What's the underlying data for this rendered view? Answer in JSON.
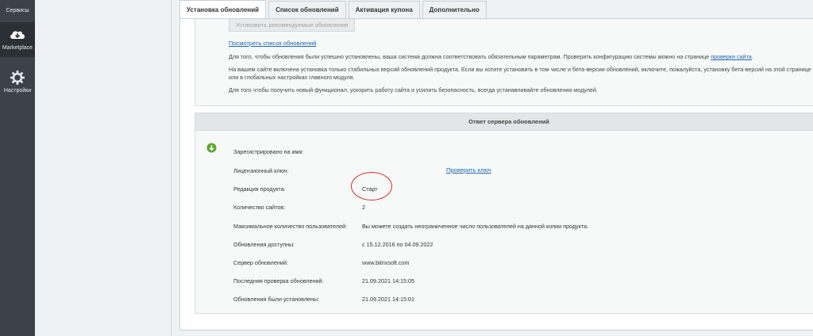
{
  "sidebar": {
    "items": [
      {
        "label": "Сервисы",
        "icon": "services-icon"
      },
      {
        "label": "Marketplace",
        "icon": "cloud-download-icon"
      },
      {
        "label": "Настройки",
        "icon": "gear-icon"
      }
    ]
  },
  "tabs": [
    {
      "label": "Установка обновлений"
    },
    {
      "label": "Список обновлений"
    },
    {
      "label": "Активация купона"
    },
    {
      "label": "Дополнительно"
    }
  ],
  "info": {
    "install_button": "Установить рекомендуемые обновления",
    "view_list_link": "Посмотреть список обновлений",
    "p1_text": "Для того, чтобы обновления были успешно установлены, ваша система должна соответствовать обязательным параметрам. Проверить конфигурацию системы можно на странице ",
    "p1_link": "проверки сайта",
    "p1_end": ".",
    "p2": "На вашем сайте включена установка только стабильных версий обновлений продукта. Если вы хотите установить в том числе и бета-версии обновлений, включите, пожалуйста, установку бета-версий на этой странице или в глобальных настройках главного модуля.",
    "p3": "Для того чтобы получить новый функционал, ускорить работу сайта и усилить безопасность, всегда устанавливайте обновления модулей."
  },
  "response": {
    "header": "Ответ сервера обновлений",
    "rows": [
      {
        "label": "Зарегистрировано на имя:",
        "value": ""
      },
      {
        "label": "Лицензионный ключ:",
        "value": ""
      },
      {
        "label": "Редакция продукта:",
        "value": "Старт"
      },
      {
        "label": "Количество сайтов:",
        "value": "2"
      },
      {
        "label": "Максимальное количество пользователей:",
        "value": "Вы можете создать неограниченное число пользователей на данной копии продукта."
      },
      {
        "label": "Обновления доступны:",
        "value": "с 15.12.2016 по 04.09.2022"
      },
      {
        "label": "Сервер обновлений:",
        "value": "www.bitrixsoft.com"
      },
      {
        "label": "Последняя проверка обновлений:",
        "value": "21.09.2021 14:15:05"
      },
      {
        "label": "Обновления были установлены:",
        "value": "21.09.2021 14:15:01"
      }
    ],
    "check_key_link": "Проверить ключ"
  },
  "colors": {
    "sidebar_bg": "#3b424a",
    "link": "#2067b0",
    "annotation_circle": "#d32b2b",
    "ok_green": "#5aa82a"
  }
}
